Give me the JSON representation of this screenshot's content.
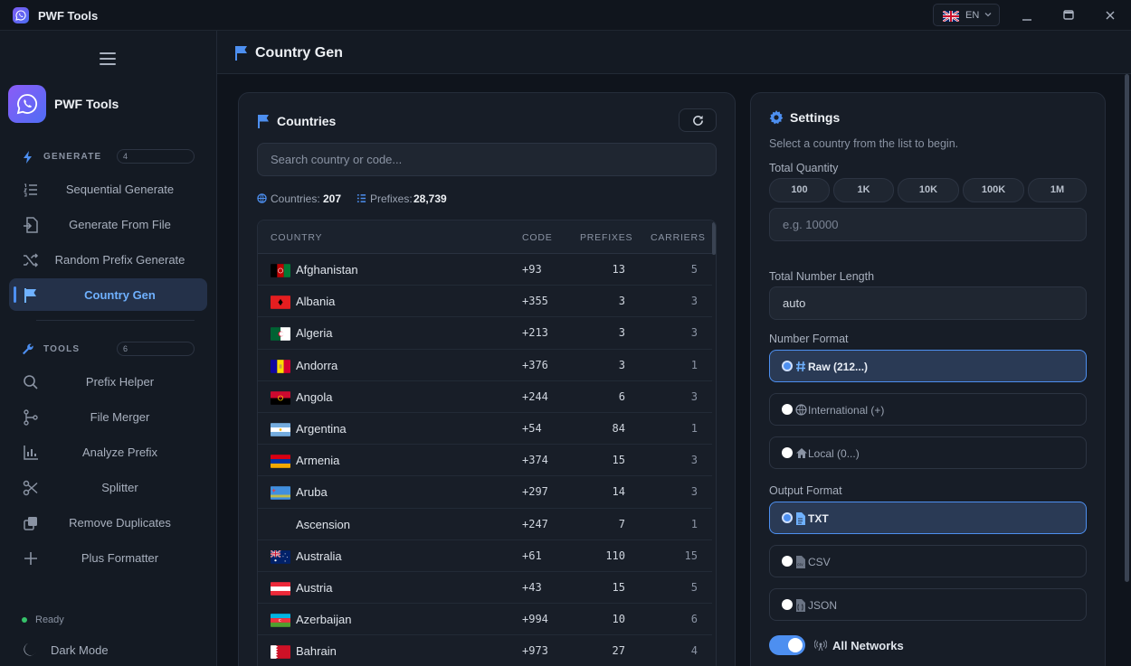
{
  "window": {
    "title": "PWF Tools",
    "language": "EN"
  },
  "sidebar": {
    "brand": "PWF Tools",
    "generate_section": {
      "label": "GENERATE",
      "count": "4"
    },
    "generate_items": [
      {
        "label": "Sequential Generate",
        "icon": "list-ordered-icon"
      },
      {
        "label": "Generate From File",
        "icon": "file-import-icon"
      },
      {
        "label": "Random Prefix Generate",
        "icon": "shuffle-icon"
      },
      {
        "label": "Country Gen",
        "icon": "flag-icon",
        "active": true
      }
    ],
    "tools_section": {
      "label": "TOOLS",
      "count": "6"
    },
    "tool_items": [
      {
        "label": "Prefix Helper",
        "icon": "search-icon"
      },
      {
        "label": "File Merger",
        "icon": "branch-icon"
      },
      {
        "label": "Analyze Prefix",
        "icon": "bar-chart-icon"
      },
      {
        "label": "Splitter",
        "icon": "scissors-icon"
      },
      {
        "label": "Remove Duplicates",
        "icon": "copy-icon"
      },
      {
        "label": "Plus Formatter",
        "icon": "plus-icon"
      }
    ],
    "status": "Ready",
    "dark_mode": "Dark Mode"
  },
  "header": {
    "title": "Country Gen"
  },
  "countries": {
    "title": "Countries",
    "search_placeholder": "Search country or code...",
    "stats": {
      "countries_label": "Countries:",
      "countries_value": "207",
      "prefixes_label": "Prefixes:",
      "prefixes_value": "28,739"
    },
    "columns": [
      "COUNTRY",
      "CODE",
      "PREFIXES",
      "CARRIERS"
    ],
    "rows": [
      {
        "name": "Afghanistan",
        "code": "+93",
        "prefixes": "13",
        "carriers": "5",
        "flag": "af"
      },
      {
        "name": "Albania",
        "code": "+355",
        "prefixes": "3",
        "carriers": "3",
        "flag": "al"
      },
      {
        "name": "Algeria",
        "code": "+213",
        "prefixes": "3",
        "carriers": "3",
        "flag": "dz"
      },
      {
        "name": "Andorra",
        "code": "+376",
        "prefixes": "3",
        "carriers": "1",
        "flag": "ad"
      },
      {
        "name": "Angola",
        "code": "+244",
        "prefixes": "6",
        "carriers": "3",
        "flag": "ao"
      },
      {
        "name": "Argentina",
        "code": "+54",
        "prefixes": "84",
        "carriers": "1",
        "flag": "ar"
      },
      {
        "name": "Armenia",
        "code": "+374",
        "prefixes": "15",
        "carriers": "3",
        "flag": "am"
      },
      {
        "name": "Aruba",
        "code": "+297",
        "prefixes": "14",
        "carriers": "3",
        "flag": "aw"
      },
      {
        "name": "Ascension",
        "code": "+247",
        "prefixes": "7",
        "carriers": "1",
        "flag": ""
      },
      {
        "name": "Australia",
        "code": "+61",
        "prefixes": "110",
        "carriers": "15",
        "flag": "au"
      },
      {
        "name": "Austria",
        "code": "+43",
        "prefixes": "15",
        "carriers": "5",
        "flag": "at"
      },
      {
        "name": "Azerbaijan",
        "code": "+994",
        "prefixes": "10",
        "carriers": "6",
        "flag": "az"
      },
      {
        "name": "Bahrain",
        "code": "+973",
        "prefixes": "27",
        "carriers": "4",
        "flag": "bh"
      }
    ]
  },
  "settings": {
    "title": "Settings",
    "hint": "Select a country from the list to begin.",
    "total_quantity_label": "Total Quantity",
    "quantity_presets": [
      "100",
      "1K",
      "10K",
      "100K",
      "1M"
    ],
    "quantity_placeholder": "e.g. 10000",
    "total_length_label": "Total Number Length",
    "length_value": "auto",
    "number_format_label": "Number Format",
    "number_formats": [
      {
        "label": "Raw (212...)",
        "icon": "hash-icon",
        "selected": true
      },
      {
        "label": "International (+)",
        "icon": "globe-icon",
        "selected": false
      },
      {
        "label": "Local (0...)",
        "icon": "home-icon",
        "selected": false
      }
    ],
    "output_format_label": "Output Format",
    "output_formats": [
      {
        "label": "TXT",
        "icon": "file-text-icon",
        "selected": true
      },
      {
        "label": "CSV",
        "icon": "file-csv-icon",
        "selected": false
      },
      {
        "label": "JSON",
        "icon": "file-json-icon",
        "selected": false
      }
    ],
    "all_networks_label": "All Networks",
    "all_networks_on": true
  },
  "colors": {
    "accent": "#4d8ff0",
    "background": "#0f141c",
    "panel": "#171d27"
  }
}
